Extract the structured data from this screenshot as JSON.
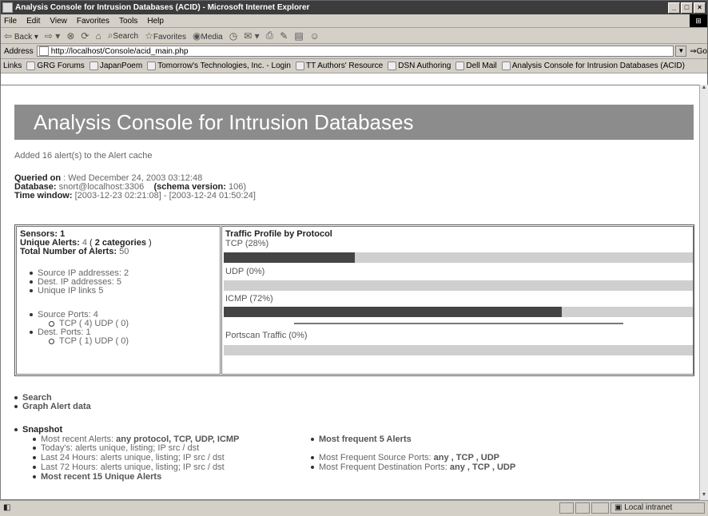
{
  "window": {
    "title": "Analysis Console for Intrusion Databases (ACID) - Microsoft Internet Explorer",
    "controls": [
      "_",
      "□",
      "×"
    ]
  },
  "menu": [
    "File",
    "Edit",
    "View",
    "Favorites",
    "Tools",
    "Help"
  ],
  "toolbar": {
    "back": "Back",
    "search": "Search",
    "favorites": "Favorites",
    "media": "Media"
  },
  "address": {
    "label": "Address",
    "url": "http://localhost/Console/acid_main.php",
    "go": "Go"
  },
  "links": {
    "label": "Links",
    "items": [
      "GRG Forums",
      "JapanPoem",
      "Tomorrow's Technologies, Inc. - Login",
      "TT Authors' Resource",
      "DSN Authoring",
      "Dell Mail",
      "Analysis Console for Intrusion Databases (ACID)"
    ]
  },
  "page": {
    "banner": "Analysis Console for Intrusion Databases",
    "cache_msg": "Added 16 alert(s) to the Alert cache",
    "queried_label": "Queried on",
    "queried_value": " : Wed December 24, 2003 03:12:48",
    "database_label": "Database:",
    "database_value": " snort@localhost:3306",
    "schema_label": "(schema version:",
    "schema_value": " 106)",
    "timewindow_label": "Time window:",
    "timewindow_value": " [2003-12-23 02:21:08] - [2003-12-24 01:50:24]"
  },
  "stats": {
    "sensors": "Sensors: 1",
    "unique_alerts_label": "Unique Alerts:",
    "unique_alerts_value": " 4",
    "categories_open": "  (  ",
    "categories_value": "2 categories",
    "categories_close": "  )",
    "total_label": "Total Number of Alerts:",
    "total_value": " 50",
    "source_ip": "Source IP addresses: 2",
    "dest_ip": "Dest. IP addresses: 5",
    "unique_links": "Unique IP links 5",
    "source_ports": "Source Ports: 4",
    "source_ports_detail": "TCP ( 4)  UDP ( 0)",
    "dest_ports": "Dest. Ports: 1",
    "dest_ports_detail": "TCP ( 1)  UDP ( 0)"
  },
  "traffic": {
    "title": "Traffic Profile by Protocol",
    "rows": [
      {
        "label": "TCP (28%)",
        "percent": 28
      },
      {
        "label": "UDP (0%)",
        "percent": 0
      },
      {
        "label": "ICMP (72%)",
        "percent": 72
      },
      {
        "label": "Portscan Traffic (0%)",
        "percent": 0
      }
    ]
  },
  "actions": {
    "search": "Search",
    "graph": "Graph Alert data",
    "snapshot": "Snapshot"
  },
  "snapshot": {
    "recent_label": "Most recent Alerts: ",
    "recent_links": "any protocol, TCP, UDP, ICMP",
    "today_label": "Today's: ",
    "today_links": "alerts unique, listing; IP src / dst",
    "last24_label": "Last 24 Hours: ",
    "last24_links": "alerts unique, listing; IP src / dst",
    "last72_label": "Last 72 Hours: ",
    "last72_links": "alerts unique, listing; IP src / dst",
    "recent15": "Most recent 15 Unique Alerts",
    "frequent5": "Most frequent 5 Alerts",
    "freq_src_label": "Most Frequent Source Ports: ",
    "freq_src_links": "any , TCP , UDP",
    "freq_dst_label": "Most Frequent Destination Ports: ",
    "freq_dst_links": "any , TCP , UDP"
  },
  "status": {
    "zone": "Local intranet"
  }
}
